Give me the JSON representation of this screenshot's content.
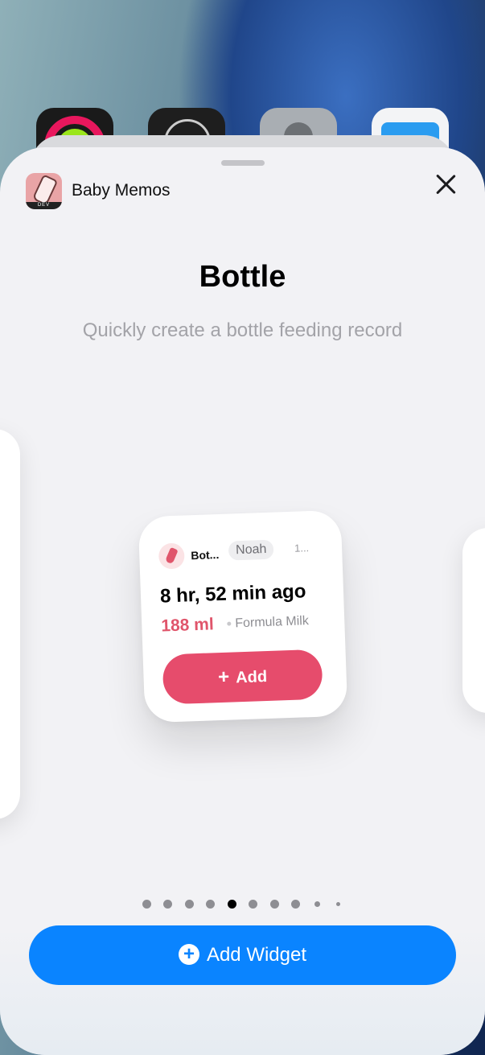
{
  "app": {
    "name": "Baby Memos",
    "icon_badge": "DEV"
  },
  "widget_gallery": {
    "title": "Bottle",
    "subtitle": "Quickly create a bottle feeding record",
    "page_count": 10,
    "active_page_index": 4
  },
  "widget": {
    "name": "Bot...",
    "child": "Noah",
    "time": "1...",
    "elapsed": "8 hr, 52 min ago",
    "amount": "188 ml",
    "type": "Formula Milk",
    "add_label": "Add",
    "add_icon": "plus-icon",
    "accent_color": "#e64c6c"
  },
  "actions": {
    "add_widget_label": "Add Widget",
    "add_widget_color": "#0a84ff"
  }
}
